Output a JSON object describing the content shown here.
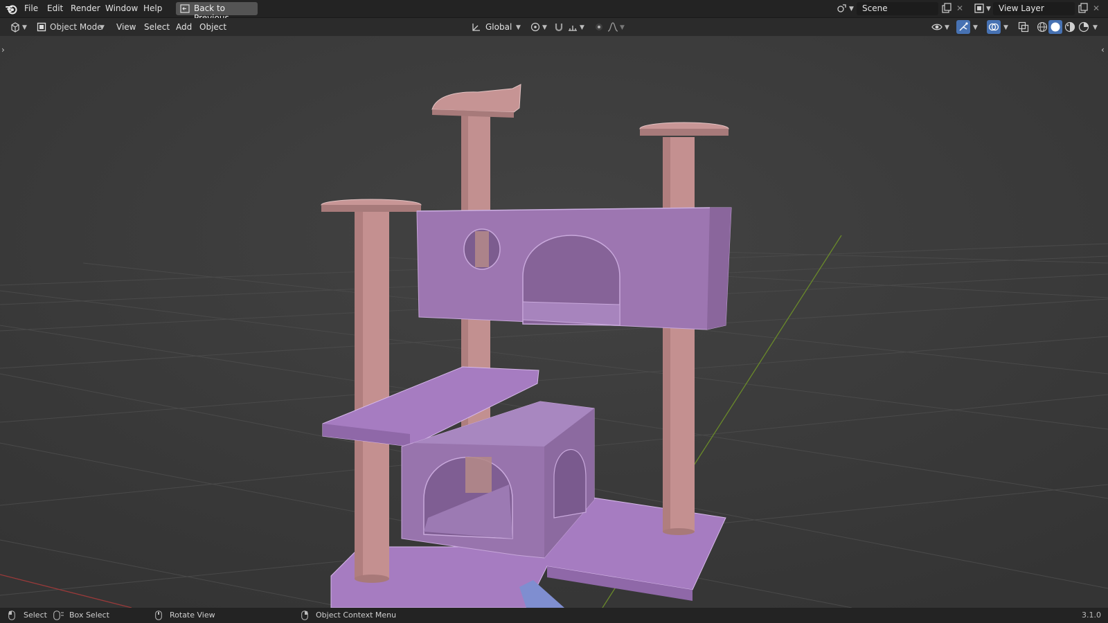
{
  "menu": {
    "items": [
      "File",
      "Edit",
      "Render",
      "Window",
      "Help"
    ],
    "back_button": "Back to Previous"
  },
  "workspace": {
    "scene_name": "Scene",
    "view_layer_name": "View Layer"
  },
  "header": {
    "mode": "Object Mode",
    "menus": [
      "View",
      "Select",
      "Add",
      "Object"
    ],
    "transform_orientation": "Global"
  },
  "status": {
    "left_click": "Select",
    "left_drag": "Box Select",
    "middle": "Rotate View",
    "right": "Object Context Menu",
    "version": "3.1.0"
  },
  "colors": {
    "accent_active": "#4772b3",
    "model_box": "#a77fc0",
    "model_post": "#c49090",
    "grid_line": "#4a4a4a",
    "x_axis": "#9a3a3a",
    "y_axis": "#6a8a2a"
  },
  "icons": {
    "app_logo": "blender-logo-icon",
    "editor_type": "3d-viewport-icon",
    "mode": "object-mode-icon",
    "orientation": "transform-orientation-icon",
    "pivot": "pivot-point-icon",
    "snap": "snap-magnet-icon",
    "proportional": "proportional-edit-icon",
    "visibility": "eye-icon",
    "gizmo": "gizmo-icon",
    "overlay": "overlay-icon",
    "xray": "xray-icon",
    "shading_wire": "wireframe-shading-icon",
    "shading_solid": "solid-shading-icon",
    "shading_material": "material-shading-icon",
    "shading_rendered": "rendered-shading-icon"
  }
}
